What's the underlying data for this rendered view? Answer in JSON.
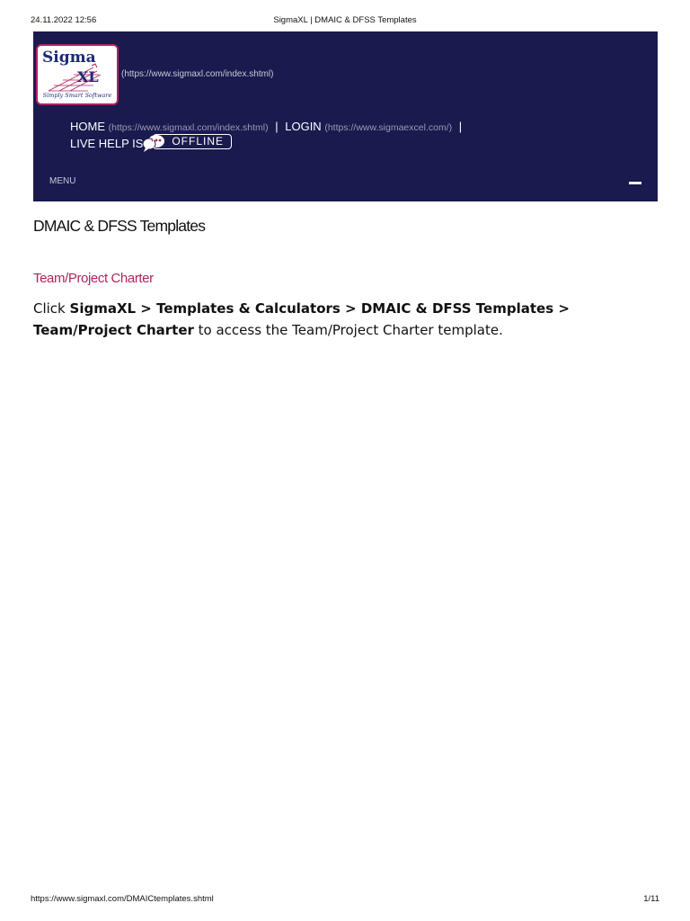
{
  "print_header": {
    "date": "24.11.2022 12:56",
    "title": "SigmaXL | DMAIC & DFSS Templates"
  },
  "site_header": {
    "logo": {
      "text": "Sigma",
      "text2": "XL",
      "tagline": "Simply Smart Software",
      "link": "(https://www.sigmaxl.com/index.shtml)"
    },
    "nav": {
      "home_label": "HOME",
      "home_url": "(https://www.sigmaxl.com/index.shtml)",
      "separator": "|",
      "login_label": "LOGIN",
      "login_url": "(https://www.sigmaexcel.com/)",
      "live_help_label": "LIVE HELP IS",
      "status_badge": "OFFLINE"
    },
    "menu_label": "MENU",
    "colors": {
      "background": "#1a1a4e",
      "logo_border": "#b0245c"
    }
  },
  "content": {
    "page_title": "DMAIC & DFSS Templates",
    "section_heading": "Team/Project Charter",
    "section_color": "#b0245c",
    "instruction": {
      "prefix": "Click ",
      "path": "SigmaXL > Templates & Calculators > DMAIC & DFSS Templates > Team/Project Charter",
      "suffix": " to access the Team/Project Charter template."
    }
  },
  "print_footer": {
    "url": "https://www.sigmaxl.com/DMAICtemplates.shtml",
    "page": "1/11"
  }
}
